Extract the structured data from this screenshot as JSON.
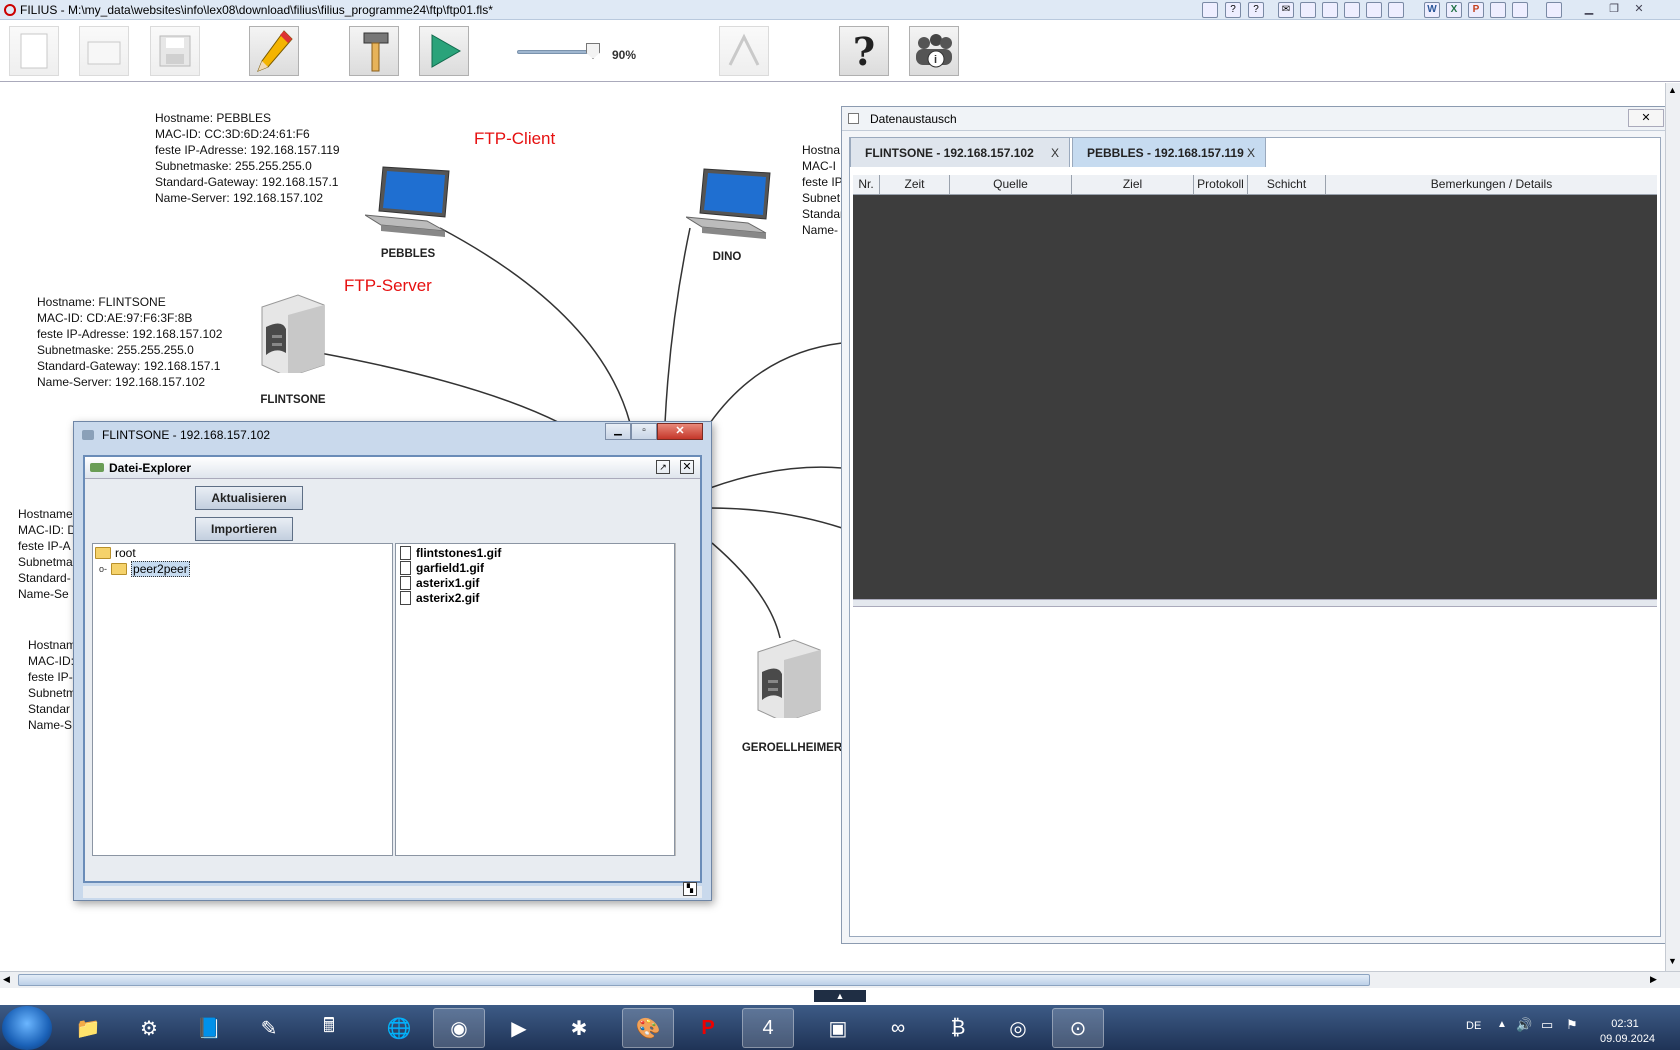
{
  "window": {
    "title": "FILIUS - M:\\my_data\\websites\\info\\lex08\\download\\filius\\filius_programme24\\ftp\\ftp01.fls*"
  },
  "toolbar": {
    "zoom": "90%",
    "zoom_value": 0.9,
    "buttons": [
      "new-file",
      "open-file",
      "save-file",
      "design-mode",
      "configure-mode",
      "simulation-mode",
      "documentation",
      "help",
      "info"
    ]
  },
  "canvas": {
    "pebbles_info": [
      "Hostname: PEBBLES",
      "MAC-ID: CC:3D:6D:24:61:F6",
      "feste IP-Adresse: 192.168.157.119",
      "Subnetmaske: 255.255.255.0",
      "Standard-Gateway: 192.168.157.1",
      "Name-Server: 192.168.157.102"
    ],
    "flintsone_info": [
      "Hostname: FLINTSONE",
      "MAC-ID: CD:AE:97:F6:3F:8B",
      "feste IP-Adresse: 192.168.157.102",
      "Subnetmaske: 255.255.255.0",
      "Standard-Gateway: 192.168.157.1",
      "Name-Server: 192.168.157.102"
    ],
    "dino_info_partial": [
      "Hostna",
      "MAC-I",
      "feste IP",
      "Subnet",
      "Standar",
      "Name-"
    ],
    "left_info_1_partial": [
      "Hostname",
      "MAC-ID: D",
      "feste IP-A",
      "Subnetma",
      "Standard-",
      "Name-Se"
    ],
    "left_info_2_partial": [
      "Hostnam",
      "MAC-ID:",
      "feste IP-",
      "Subnetm",
      "Standar",
      "Name-S"
    ],
    "labels": {
      "ftp_client": "FTP-Client",
      "ftp_server": "FTP-Server",
      "pebbles": "PEBBLES",
      "dino": "DINO",
      "flintsone": "FLINTSONE",
      "geroellheimer": "GEROELLHEIMER"
    }
  },
  "flintsone_window": {
    "title": "FLINTSONE - 192.168.157.102",
    "inner_title": "Datei-Explorer",
    "buttons": {
      "refresh": "Aktualisieren",
      "import": "Importieren"
    },
    "tree": {
      "root": "root",
      "child": "peer2peer"
    },
    "files": [
      "flintstones1.gif",
      "garfield1.gif",
      "asterix1.gif",
      "asterix2.gif"
    ]
  },
  "data_window": {
    "title": "Datenaustausch",
    "tabs": [
      {
        "label": "FLINTSONE - 192.168.157.102",
        "close": "X"
      },
      {
        "label": "PEBBLES - 192.168.157.119",
        "close": "X"
      }
    ],
    "columns": [
      "Nr.",
      "Zeit",
      "Quelle",
      "Ziel",
      "Protokoll",
      "Schicht",
      "Bemerkungen / Details"
    ]
  },
  "taskbar": {
    "language": "DE",
    "time": "02:31",
    "date": "09.09.2024"
  }
}
